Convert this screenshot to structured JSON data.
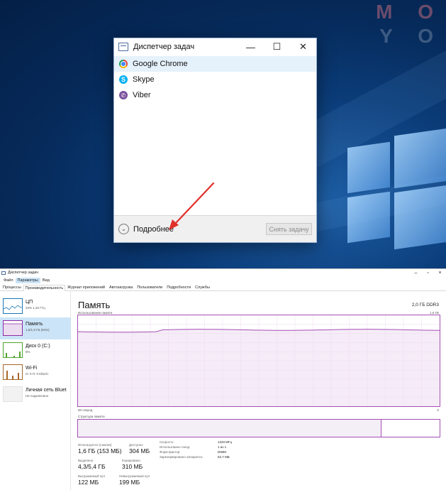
{
  "watermark": {
    "line1": "M O",
    "line2": "Y O"
  },
  "compact_tm": {
    "title": "Диспетчер задач",
    "controls": {
      "minimize": "—",
      "maximize": "☐",
      "close": "✕"
    },
    "apps": [
      {
        "name": "Google Chrome",
        "selected": true
      },
      {
        "name": "Skype",
        "selected": false
      },
      {
        "name": "Viber",
        "selected": false
      }
    ],
    "more_details": "Подробнее",
    "end_task": "Снять задачу",
    "icons": {
      "title": "task-manager-icon",
      "more": "chevron-down-icon"
    }
  },
  "full_tm": {
    "title": "Диспетчер задач",
    "controls": {
      "minimize": "–",
      "maximize": "▫",
      "close": "×"
    },
    "menu": [
      "Файл",
      "Параметры",
      "Вид"
    ],
    "menu_active": "Параметры",
    "tabs": [
      "Процессы",
      "Производительность",
      "Журнал приложений",
      "Автозагрузка",
      "Пользователи",
      "Подробности",
      "Службы"
    ],
    "tab_active": "Производительность",
    "sidebar": [
      {
        "name": "ЦП",
        "sub": "34% 1,32 ГГц",
        "color": "#1b79b8",
        "selected": false
      },
      {
        "name": "Память",
        "sub": "1,6/1,9 ГБ (84%)",
        "color": "#8c2ba3",
        "selected": true
      },
      {
        "name": "Диск 0 (C:)",
        "sub": "6%",
        "color": "#4da42a",
        "selected": false
      },
      {
        "name": "Wi-Fi",
        "sub": "О: 0 П: 0 Кбит/с",
        "color": "#a8662a",
        "selected": false
      },
      {
        "name": "Личная сеть Bluet",
        "sub": "Не подключено",
        "color": "#a0a0a0",
        "selected": false
      }
    ],
    "main": {
      "title": "Память",
      "spec": "2,0 ГБ DDR3",
      "usage_label": "Использование памяти",
      "usage_max": "1,9 ГБ",
      "time_label": "60 секунд",
      "zero_label": "0",
      "structure_label": "Структура памяти",
      "structure_used_fraction": 0.84,
      "usage_fraction": 0.84,
      "stats": {
        "in_use_label": "Используется (сжатая)",
        "in_use": "1,6 ГБ (153 МБ)",
        "available_label": "Доступно",
        "available": "304 МБ",
        "committed_label": "Выделено",
        "committed": "4,3/5,4 ГБ",
        "cached_label": "Кэшировано",
        "cached": "310 МБ",
        "paged_label": "Выгружаемый пул",
        "paged": "122 МБ",
        "nonpaged_label": "Невыгружаемый пул",
        "nonpaged": "199 МБ"
      },
      "details": [
        {
          "k": "Скорость:",
          "v": "1333 МГц"
        },
        {
          "k": "Использовано гнезд:",
          "v": "1 из 1"
        },
        {
          "k": "Форм-фактор:",
          "v": "DIMM"
        },
        {
          "k": "Зарезервировано аппаратно:",
          "v": "62,7 МБ"
        }
      ]
    }
  },
  "annotation_arrow_color": "#e0302a"
}
